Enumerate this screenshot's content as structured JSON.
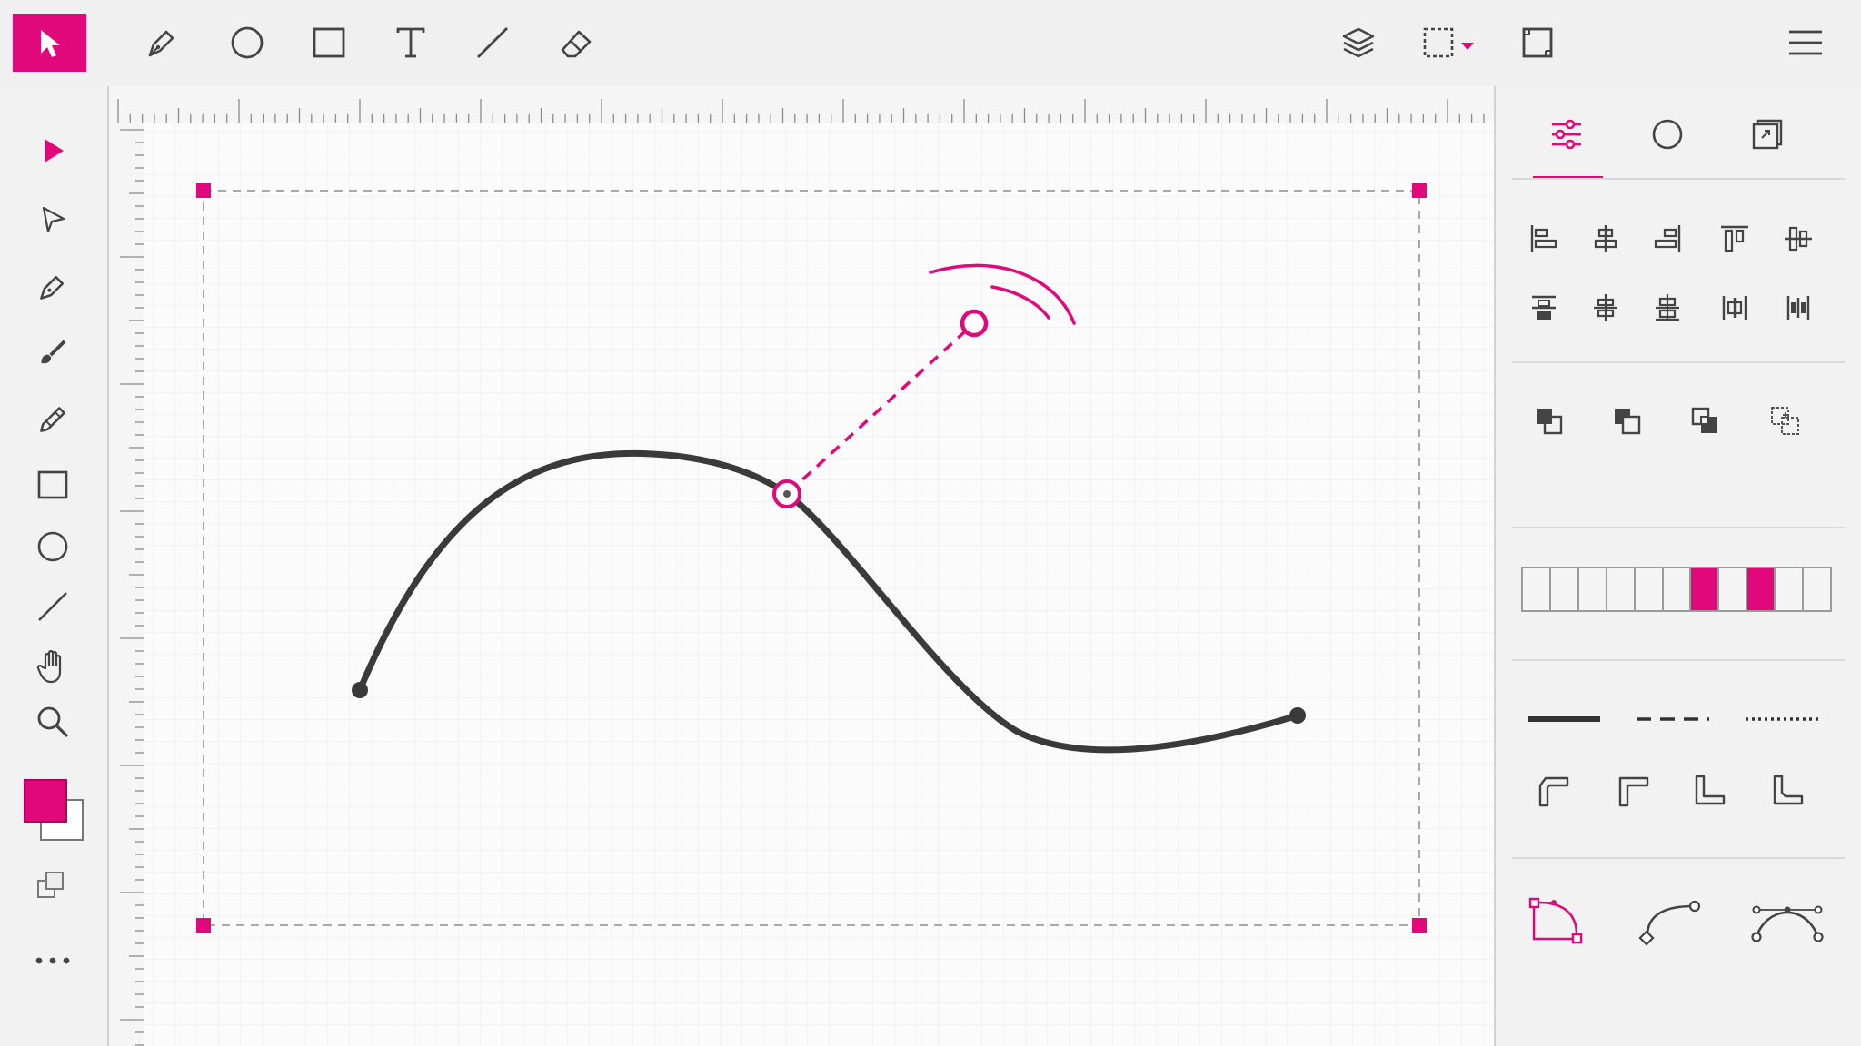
{
  "colors": {
    "accent": "#E0087A",
    "stroke": "#3A3A3A",
    "icon": "#444444",
    "chrome": "#F0F0F0",
    "canvas": "#FBFBFB",
    "grid": "#EAEAEA"
  },
  "top_toolbar": {
    "left_tools": [
      "select-icon",
      "pen-icon",
      "ellipse-icon",
      "rectangle-icon",
      "text-icon",
      "line-icon",
      "eraser-icon"
    ],
    "active_tool": "select-icon",
    "right_tools": [
      "layers-icon",
      "marquee-select-icon",
      "frame-icon",
      "menu-icon"
    ]
  },
  "left_toolbar": {
    "tools": [
      "select-arrow-icon",
      "direct-select-icon",
      "pen-icon",
      "brush-icon",
      "pencil-icon",
      "rectangle-icon",
      "ellipse-icon",
      "line-icon",
      "hand-icon",
      "zoom-icon"
    ],
    "fill_color": "#E0087A",
    "stroke_color": "#FFFFFF",
    "extra_tools": [
      "swap-colors-icon",
      "more-icon"
    ]
  },
  "right_panel": {
    "tabs": [
      "adjust-tab-icon",
      "shape-tab-icon",
      "transform-tab-icon"
    ],
    "active_tab": 0,
    "align_tools": [
      "align-left-icon",
      "align-center-icon",
      "align-right-icon",
      "align-top-icon",
      "align-middle-icon",
      "distribute-top-icon",
      "distribute-center-icon",
      "distribute-bottom-icon",
      "distribute-horizontal-icon",
      "distribute-vertical-icon"
    ],
    "arrange_tools": [
      "bring-front-icon",
      "bring-forward-icon",
      "send-backward-icon",
      "group-icon"
    ],
    "swatch_selected": [
      6,
      8
    ],
    "swatch_count": 11,
    "line_styles": [
      "solid-line-icon",
      "dashed-line-icon",
      "dotted-line-icon"
    ],
    "corner_tools": [
      "corner-round-icon",
      "corner-bevel-icon",
      "corner-miter-icon",
      "corner-inset-icon"
    ],
    "path_tools": [
      "bezier-node-icon",
      "curve-handle-icon",
      "path-points-icon"
    ]
  }
}
